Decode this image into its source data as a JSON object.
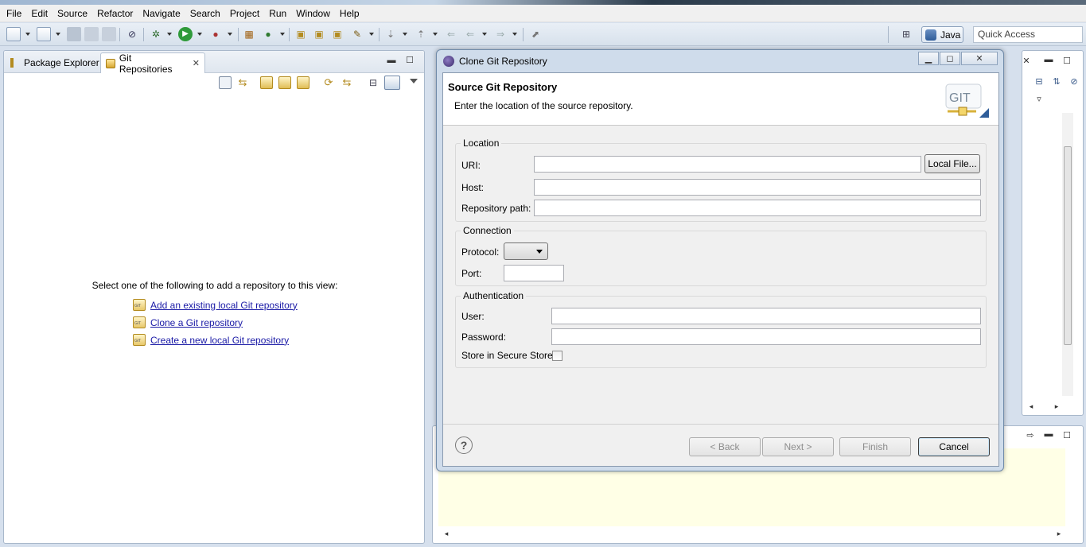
{
  "menubar": {
    "items": [
      "File",
      "Edit",
      "Source",
      "Refactor",
      "Navigate",
      "Search",
      "Project",
      "Run",
      "Window",
      "Help"
    ]
  },
  "toolbar": {
    "perspective_label": "Java",
    "quick_access_placeholder": "Quick Access"
  },
  "left_view": {
    "tabs": [
      "Package Explorer",
      "Git Repositories"
    ],
    "active_tab": "Git Repositories",
    "empty_message": "Select one of the following to add a repository to this view:",
    "links": [
      "Add an existing local Git repository",
      "Clone a Git repository",
      "Create a new local Git repository"
    ]
  },
  "dialog": {
    "window_title": "Clone Git Repository",
    "header_title": "Source Git Repository",
    "header_description": "Enter the location of the source repository.",
    "logo_text": "GIT",
    "location": {
      "group_label": "Location",
      "uri_label": "URI:",
      "uri_value": "",
      "local_file_button": "Local File...",
      "host_label": "Host:",
      "host_value": "",
      "repo_path_label": "Repository path:",
      "repo_path_value": ""
    },
    "connection": {
      "group_label": "Connection",
      "protocol_label": "Protocol:",
      "protocol_value": "",
      "port_label": "Port:",
      "port_value": ""
    },
    "authentication": {
      "group_label": "Authentication",
      "user_label": "User:",
      "user_value": "",
      "password_label": "Password:",
      "password_value": "",
      "store_label": "Store in Secure Store",
      "store_checked": false
    },
    "buttons": {
      "help": "?",
      "back": "< Back",
      "next": "Next >",
      "finish": "Finish",
      "cancel": "Cancel"
    }
  },
  "colors": {
    "link": "#1a1aa6",
    "console_bg": "#ffffe6",
    "dialog_frame": "#cfdceb"
  }
}
